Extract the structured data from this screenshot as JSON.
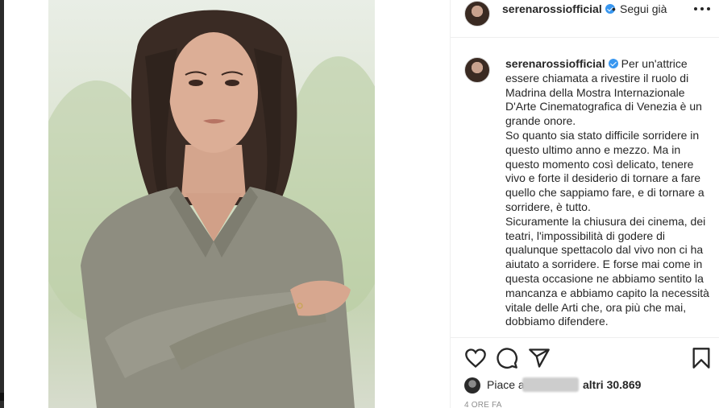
{
  "post": {
    "author": "serenarossiofficial",
    "verified": true,
    "follow_separator": "•",
    "follow_label": "Segui già",
    "caption_author": "serenarossiofficial",
    "caption_lines": [
      "Per un'attrice essere chiamata a rivestire il ruolo di Madrina della Mostra Internazionale D'Arte Cinematografica di Venezia è un grande onore.",
      "So quanto sia stato difficile sorridere in questo ultimo anno e mezzo. Ma in questo momento così delicato, tenere vivo e forte il desiderio di tornare a fare quello che sappiamo fare, e di tornare a sorridere, è tutto.",
      "Sicuramente la chiusura dei cinema, dei teatri, l'impossibilità di godere di qualunque spettacolo dal vivo non ci ha aiutato a sorridere. E forse mai come in questa occasione ne abbiamo sentito la mancanza e abbiamo capito la necessità vitale delle Arti che, ora più che mai, dobbiamo difendere."
    ],
    "likes_prefix": "Piace a",
    "likes_suffix": "altri 30.869",
    "timestamp": "4 ORE FA"
  },
  "icons": {
    "more": "more-options-icon",
    "like": "heart-icon",
    "comment": "comment-bubble-icon",
    "share": "paper-plane-icon",
    "save": "bookmark-icon",
    "verified": "verified-badge-icon"
  },
  "colors": {
    "verified": "#3897f0",
    "text": "#262626",
    "muted": "#8e8e8e",
    "border": "#efefef"
  }
}
